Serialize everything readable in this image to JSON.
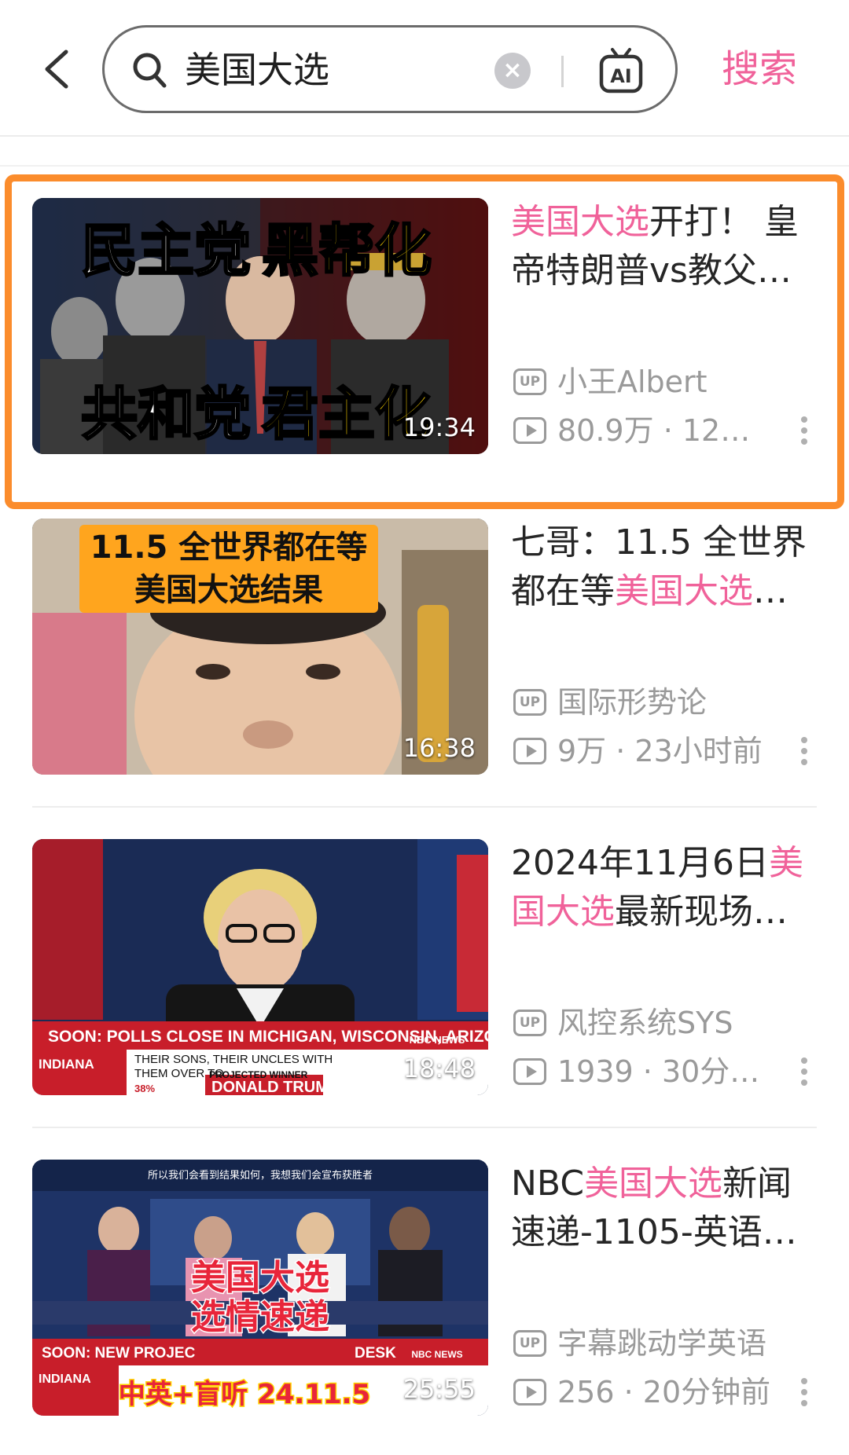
{
  "header": {
    "search_query": "美国大选",
    "clear_label": "×",
    "ai_label": "AI",
    "search_button": "搜索"
  },
  "results": [
    {
      "title_highlight": "美国大选",
      "title_rest": "开打！ 皇帝特朗普vs教父…",
      "title_pre": "",
      "uploader": "小王Albert",
      "stats": "80.9万 · 12…",
      "duration": "19:34",
      "thumb_text_top": [
        "民主党",
        "黑帮化"
      ],
      "thumb_text_bottom": [
        "共和党",
        "君主化"
      ]
    },
    {
      "title_pre": "七哥：11.5 全世界都在等",
      "title_highlight": "美国大选",
      "title_rest": "…",
      "uploader": "国际形势论",
      "stats": "9万 · 23小时前",
      "duration": "16:38",
      "thumb_text_top": [
        "11.5 全世界都在等"
      ],
      "thumb_text_bottom": [
        "美国大选结果"
      ]
    },
    {
      "title_pre": "2024年11月6日",
      "title_highlight": "美国大选",
      "title_rest": "最新现场…",
      "uploader": "风控系统SYS",
      "stats": "1939 · 30分…",
      "duration": "18:48",
      "ticker": [
        "SOON: POLLS CLOSE IN MICHIGAN, WISCONSIN, ARIZONA",
        "NBC NEWS",
        "INDIANA",
        "THEIR SONS, THEIR UNCLES WITH",
        "THEM OVER TO",
        "PROJECTED WINNER",
        "DONALD TRUMP",
        "38%"
      ]
    },
    {
      "title_pre": "NBC",
      "title_highlight": "美国大选",
      "title_rest": "新闻速递-1105-英语…",
      "uploader": "字幕跳动学英语",
      "stats": "256 · 20分钟前",
      "duration": "25:55",
      "thumb_text_top": [
        "美国大选"
      ],
      "thumb_text_bottom": [
        "选情速递"
      ],
      "thumb_caption": "所以我们会看到结果如何，我想我们会宣布获胜者",
      "thumb_sub": "中英+盲听 24.11.5",
      "ticker": [
        "SOON: NEW PROJEC",
        "DESK",
        "NBC NEWS",
        "INDIANA"
      ]
    }
  ],
  "colors": {
    "accent_pink": "#f0629a",
    "highlight_orange": "#fb8c2c",
    "meta_gray": "#9a9a9a"
  }
}
